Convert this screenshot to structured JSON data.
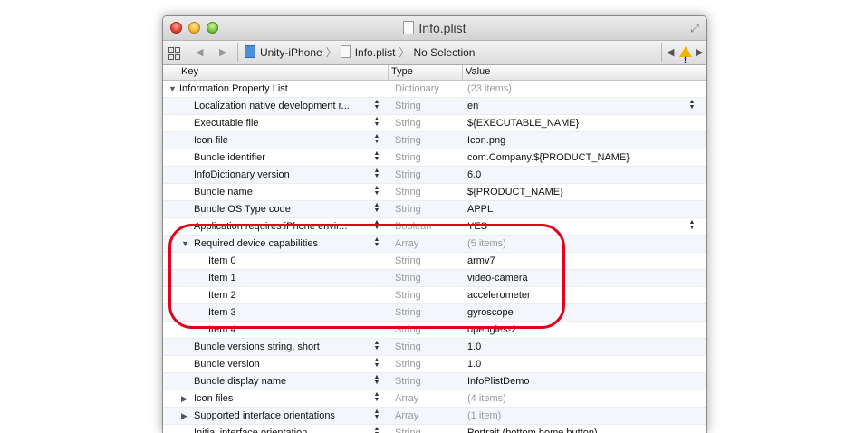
{
  "window": {
    "title": "Info.plist"
  },
  "jumpbar": {
    "project": "Unity-iPhone",
    "file": "Info.plist",
    "selection": "No Selection"
  },
  "columns": {
    "key": "Key",
    "type": "Type",
    "value": "Value"
  },
  "rows": [
    {
      "key": "Information Property List",
      "type": "Dictionary",
      "value": "(23 items)",
      "level": 0,
      "disclosure": "expanded",
      "muted_value": true,
      "stepper": false,
      "value_stepper": false
    },
    {
      "key": "Localization native development r...",
      "type": "String",
      "value": "en",
      "level": 1,
      "disclosure": "",
      "muted_value": false,
      "stepper": true,
      "value_stepper": true
    },
    {
      "key": "Executable file",
      "type": "String",
      "value": "${EXECUTABLE_NAME}",
      "level": 1,
      "disclosure": "",
      "muted_value": false,
      "stepper": true,
      "value_stepper": false
    },
    {
      "key": "Icon file",
      "type": "String",
      "value": "Icon.png",
      "level": 1,
      "disclosure": "",
      "muted_value": false,
      "stepper": true,
      "value_stepper": false
    },
    {
      "key": "Bundle identifier",
      "type": "String",
      "value": "com.Company.${PRODUCT_NAME}",
      "level": 1,
      "disclosure": "",
      "muted_value": false,
      "stepper": true,
      "value_stepper": false
    },
    {
      "key": "InfoDictionary version",
      "type": "String",
      "value": "6.0",
      "level": 1,
      "disclosure": "",
      "muted_value": false,
      "stepper": true,
      "value_stepper": false
    },
    {
      "key": "Bundle name",
      "type": "String",
      "value": "${PRODUCT_NAME}",
      "level": 1,
      "disclosure": "",
      "muted_value": false,
      "stepper": true,
      "value_stepper": false
    },
    {
      "key": "Bundle OS Type code",
      "type": "String",
      "value": "APPL",
      "level": 1,
      "disclosure": "",
      "muted_value": false,
      "stepper": true,
      "value_stepper": false
    },
    {
      "key": "Application requires iPhone envir...",
      "type": "Boolean",
      "value": "YES",
      "level": 1,
      "disclosure": "",
      "muted_value": false,
      "stepper": true,
      "value_stepper": true
    },
    {
      "key": "Required device capabilities",
      "type": "Array",
      "value": "(5 items)",
      "level": 1,
      "disclosure": "expanded",
      "muted_value": true,
      "stepper": true,
      "value_stepper": false
    },
    {
      "key": "Item 0",
      "type": "String",
      "value": "armv7",
      "level": 2,
      "disclosure": "",
      "muted_value": false,
      "stepper": false,
      "value_stepper": false
    },
    {
      "key": "Item 1",
      "type": "String",
      "value": "video-camera",
      "level": 2,
      "disclosure": "",
      "muted_value": false,
      "stepper": false,
      "value_stepper": false
    },
    {
      "key": "Item 2",
      "type": "String",
      "value": "accelerometer",
      "level": 2,
      "disclosure": "",
      "muted_value": false,
      "stepper": false,
      "value_stepper": false
    },
    {
      "key": "Item 3",
      "type": "String",
      "value": "gyroscope",
      "level": 2,
      "disclosure": "",
      "muted_value": false,
      "stepper": false,
      "value_stepper": false
    },
    {
      "key": "Item 4",
      "type": "String",
      "value": "opengles-2",
      "level": 2,
      "disclosure": "",
      "muted_value": false,
      "stepper": false,
      "value_stepper": false
    },
    {
      "key": "Bundle versions string, short",
      "type": "String",
      "value": "1.0",
      "level": 1,
      "disclosure": "",
      "muted_value": false,
      "stepper": true,
      "value_stepper": false
    },
    {
      "key": "Bundle version",
      "type": "String",
      "value": "1.0",
      "level": 1,
      "disclosure": "",
      "muted_value": false,
      "stepper": true,
      "value_stepper": false
    },
    {
      "key": "Bundle display name",
      "type": "String",
      "value": "InfoPlistDemo",
      "level": 1,
      "disclosure": "",
      "muted_value": false,
      "stepper": true,
      "value_stepper": false
    },
    {
      "key": "Icon files",
      "type": "Array",
      "value": "(4 items)",
      "level": 1,
      "disclosure": "collapsed",
      "muted_value": true,
      "stepper": true,
      "value_stepper": false
    },
    {
      "key": "Supported interface orientations",
      "type": "Array",
      "value": "(1 item)",
      "level": 1,
      "disclosure": "collapsed",
      "muted_value": true,
      "stepper": true,
      "value_stepper": false
    },
    {
      "key": "Initial interface orientation",
      "type": "String",
      "value": "Portrait (bottom home button)",
      "level": 1,
      "disclosure": "",
      "muted_value": false,
      "stepper": true,
      "value_stepper": false
    }
  ],
  "colors": {
    "highlight": "#e4001b",
    "alt_row": "#f3f6fa"
  }
}
